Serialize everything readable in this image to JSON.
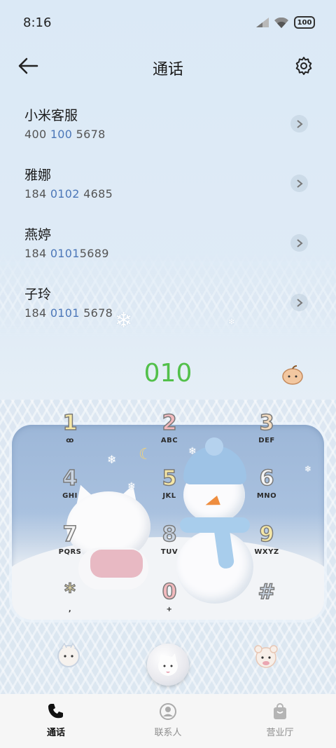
{
  "status_bar": {
    "time": "8:16",
    "battery": "100"
  },
  "header": {
    "title": "通话"
  },
  "contacts": [
    {
      "name": "小米客服",
      "number_pre": "400 ",
      "number_hl": "100",
      "number_post": " 5678"
    },
    {
      "name": "雅娜",
      "number_pre": "184 ",
      "number_hl": "0102",
      "number_post": " 4685"
    },
    {
      "name": "燕婷",
      "number_pre": "184 ",
      "number_hl": "0101",
      "number_post": "5689"
    },
    {
      "name": "子玲",
      "number_pre": "184 ",
      "number_hl": "0101",
      "number_post": " 5678"
    }
  ],
  "dialer": {
    "input": "010",
    "keys": [
      {
        "digit": "1",
        "letters": "ꝏ",
        "color": "#f5e7a6"
      },
      {
        "digit": "2",
        "letters": "ABC",
        "color": "#f2b9bd"
      },
      {
        "digit": "3",
        "letters": "DEF",
        "color": "#f4dcc0"
      },
      {
        "digit": "4",
        "letters": "GHI",
        "color": "#c9d4e2"
      },
      {
        "digit": "5",
        "letters": "JKL",
        "color": "#f5e7a6"
      },
      {
        "digit": "6",
        "letters": "MNO",
        "color": "#f4f4f4"
      },
      {
        "digit": "7",
        "letters": "PQRS",
        "color": "#f4f4f4"
      },
      {
        "digit": "8",
        "letters": "TUV",
        "color": "#c9d4e2"
      },
      {
        "digit": "9",
        "letters": "WXYZ",
        "color": "#f5e7a6"
      },
      {
        "digit": "*",
        "letters": ",",
        "color": "#f5e7a6"
      },
      {
        "digit": "0",
        "letters": "+",
        "color": "#f2b9bd"
      },
      {
        "digit": "#",
        "letters": "",
        "color": "#c9d4e2"
      }
    ]
  },
  "bottom_nav": [
    {
      "label": "通话",
      "icon": "phone-icon",
      "active": true
    },
    {
      "label": "联系人",
      "icon": "person-icon",
      "active": false
    },
    {
      "label": "营业厅",
      "icon": "shopping-bag-icon",
      "active": false
    }
  ],
  "colors": {
    "accent_green": "#52c04a",
    "number_highlight": "#4c77b8"
  }
}
